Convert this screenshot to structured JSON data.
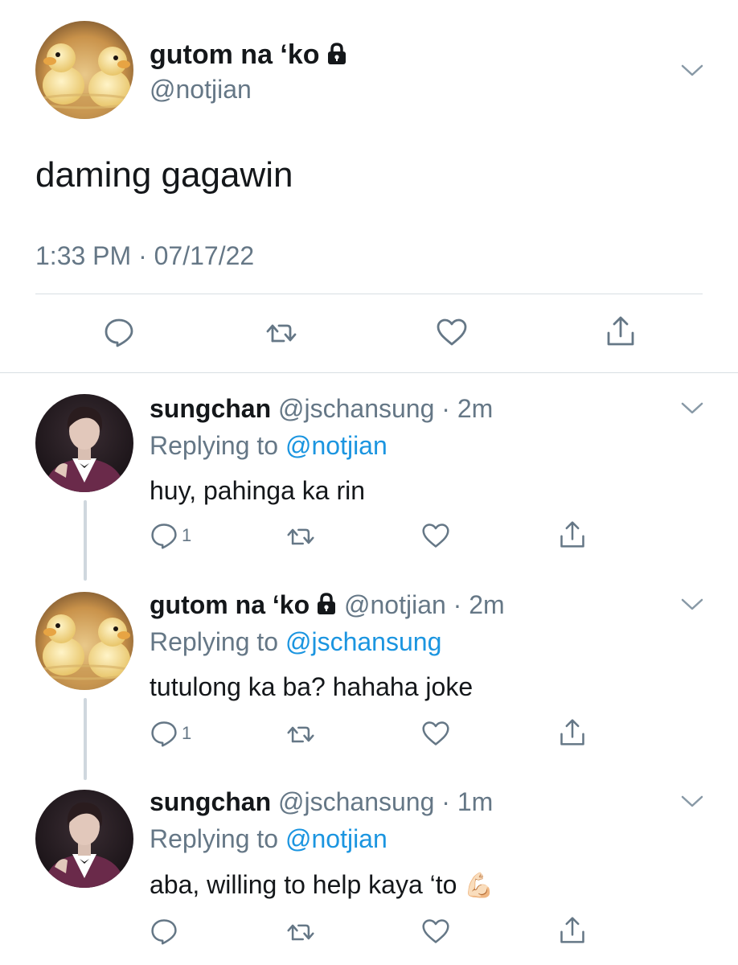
{
  "main_tweet": {
    "display_name": "gutom na ‘ko",
    "handle": "@notjian",
    "text": "daming gagawin",
    "timestamp": "1:33 PM · 07/17/22",
    "avatar": "duck-figurine-avatar",
    "locked": true
  },
  "replies": [
    {
      "display_name": "sungchan",
      "handle": "@jschansung",
      "time": "2m",
      "replying_label": "Replying to",
      "replying_to": "@notjian",
      "text": "huy, pahinga ka rin",
      "reply_count": "1",
      "avatar": "person-in-suit-avatar",
      "locked": false
    },
    {
      "display_name": "gutom na ‘ko",
      "handle": "@notjian",
      "time": "2m",
      "replying_label": "Replying to",
      "replying_to": "@jschansung",
      "text": "tutulong ka ba? hahaha joke",
      "reply_count": "1",
      "avatar": "duck-figurine-avatar",
      "locked": true
    },
    {
      "display_name": "sungchan",
      "handle": "@jschansung",
      "time": "1m",
      "replying_label": "Replying to",
      "replying_to": "@notjian",
      "text": "aba, willing to help kaya ‘to",
      "emoji": "💪🏻",
      "reply_count": "",
      "avatar": "person-in-suit-avatar",
      "locked": false
    }
  ],
  "colors": {
    "text": "#14171a",
    "muted": "#657786",
    "link": "#1b95e0",
    "divider": "#d8dee3",
    "thread_line": "#cfd7de"
  }
}
